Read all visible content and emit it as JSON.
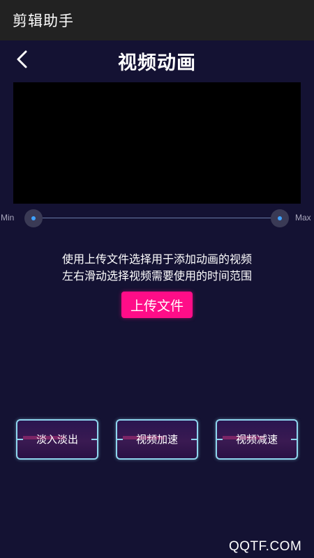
{
  "app_bar": {
    "title": "剪辑助手"
  },
  "header": {
    "back_icon": "chevron-left-icon",
    "title": "视频动画"
  },
  "video_preview": {
    "background": "#000000"
  },
  "range_slider": {
    "min_label": "Min",
    "max_label": "Max",
    "start": 0,
    "end": 1
  },
  "hint": {
    "line1": "使用上传文件选择用于添加动画的视频",
    "line2": "左右滑动选择视频需要使用的时间范围"
  },
  "upload_button": {
    "label": "上传文件",
    "color": "#ff0d88"
  },
  "effects": [
    {
      "label": "淡入淡出"
    },
    {
      "label": "视频加速"
    },
    {
      "label": "视频减速"
    }
  ],
  "watermark": "QQTF.COM",
  "colors": {
    "background": "#141233",
    "app_bar": "#222222",
    "accent": "#ff0d88",
    "button_border": "#8fd6ee"
  }
}
